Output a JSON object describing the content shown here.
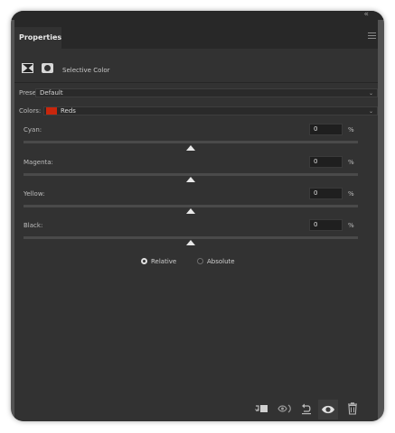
{
  "panel": {
    "tab_label": "Properties",
    "collapse_icon": "double-chevron-left-icon",
    "menu_icon": "panel-menu-icon"
  },
  "adjustment": {
    "icon": "selective-color-adjustment-icon",
    "mask_icon": "layer-mask-icon",
    "title": "Selective Color"
  },
  "preset": {
    "label": "Preset:",
    "value": "Default"
  },
  "colors": {
    "label": "Colors:",
    "value": "Reds",
    "swatch_color": "#c8260c"
  },
  "sliders": [
    {
      "label": "Cyan:",
      "value": "0",
      "unit": "%"
    },
    {
      "label": "Magenta:",
      "value": "0",
      "unit": "%"
    },
    {
      "label": "Yellow:",
      "value": "0",
      "unit": "%"
    },
    {
      "label": "Black:",
      "value": "0",
      "unit": "%"
    }
  ],
  "method": {
    "options": [
      "Relative",
      "Absolute"
    ],
    "selected": "Relative"
  },
  "footer_icons": [
    "clip-to-layer-icon",
    "view-previous-state-icon",
    "reset-icon",
    "visibility-eye-icon",
    "trash-icon"
  ],
  "colors_theme": {
    "panel_bg": "#323232",
    "tab_bar_bg": "#282828",
    "frame_bg": "#535353",
    "text": "#c8c8c8"
  }
}
